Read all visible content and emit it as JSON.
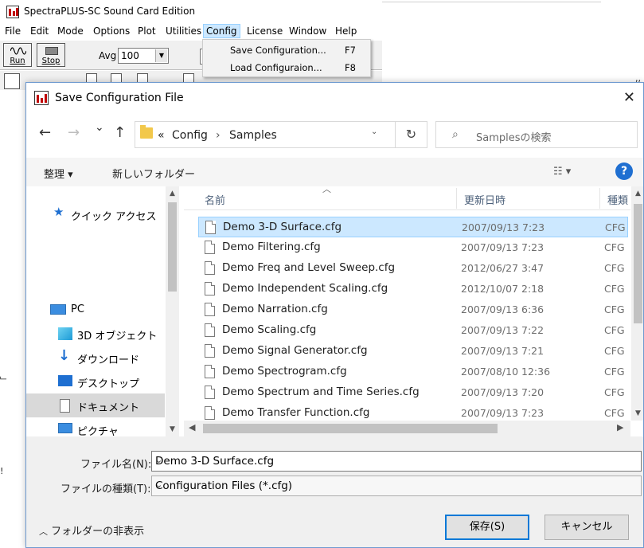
{
  "app": {
    "title": "SpectraPLUS-SC Sound Card Edition",
    "menu": [
      "File",
      "Edit",
      "Mode",
      "Options",
      "Plot",
      "Utilities",
      "Config",
      "License",
      "Window",
      "Help"
    ],
    "active_menu": "Config",
    "run_label": "Run",
    "stop_label": "Stop",
    "avg_label": "Avg",
    "avg_value": "100"
  },
  "config_menu": {
    "items": [
      {
        "label": "Save Configuration...",
        "shortcut": "F7"
      },
      {
        "label": "Load Configuraion...",
        "shortcut": "F8"
      }
    ]
  },
  "dialog": {
    "title": "Save Configuration File",
    "close": "✕",
    "nav": {
      "back": "←",
      "forward": "→",
      "recent": "⌄",
      "up": "↑"
    },
    "address": {
      "chevron": "«",
      "parts": [
        "Config",
        "Samples"
      ],
      "sep": "›",
      "dropdown": "⌄",
      "refresh": "↻"
    },
    "search": {
      "icon": "⌕",
      "placeholder": "Samplesの検索"
    },
    "toolbar": {
      "organize": "整理 ▾",
      "new_folder": "新しいフォルダー",
      "view": "☷ ▾",
      "help": "?"
    },
    "nav_pane": [
      {
        "label": "クイック アクセス",
        "icon": "star-icon"
      },
      {
        "label": "PC",
        "icon": "computer-icon"
      },
      {
        "label": "3D オブジェクト",
        "icon": "cube-icon"
      },
      {
        "label": "ダウンロード",
        "icon": "download-icon"
      },
      {
        "label": "デスクトップ",
        "icon": "desktop-icon"
      },
      {
        "label": "ドキュメント",
        "icon": "document-icon"
      },
      {
        "label": "ピクチャ",
        "icon": "picture-icon"
      }
    ],
    "columns": {
      "name": "名前",
      "date": "更新日時",
      "type": "種類"
    },
    "files": [
      {
        "name": "Demo 3-D Surface.cfg",
        "date": "2007/09/13 7:23",
        "type": "CFG"
      },
      {
        "name": "Demo Filtering.cfg",
        "date": "2007/09/13 7:23",
        "type": "CFG"
      },
      {
        "name": "Demo Freq and Level Sweep.cfg",
        "date": "2012/06/27 3:47",
        "type": "CFG"
      },
      {
        "name": "Demo Independent Scaling.cfg",
        "date": "2012/10/07 2:18",
        "type": "CFG"
      },
      {
        "name": "Demo Narration.cfg",
        "date": "2007/09/13 6:36",
        "type": "CFG"
      },
      {
        "name": "Demo Scaling.cfg",
        "date": "2007/09/13 7:22",
        "type": "CFG"
      },
      {
        "name": "Demo Signal Generator.cfg",
        "date": "2007/09/13 7:21",
        "type": "CFG"
      },
      {
        "name": "Demo Spectrogram.cfg",
        "date": "2007/08/10 12:36",
        "type": "CFG"
      },
      {
        "name": "Demo Spectrum and Time Series.cfg",
        "date": "2007/09/13 7:20",
        "type": "CFG"
      },
      {
        "name": "Demo Transfer Function.cfg",
        "date": "2007/09/13 7:23",
        "type": "CFG"
      }
    ],
    "filename_label": "ファイル名(N):",
    "filename_value": "Demo 3-D Surface.cfg",
    "filetype_label": "ファイルの種類(T):",
    "filetype_value": "Configuration Files (*.cfg)",
    "hide_folders": "フォルダーの非表示",
    "save_button": "保存(S)",
    "cancel_button": "キャンセル"
  }
}
